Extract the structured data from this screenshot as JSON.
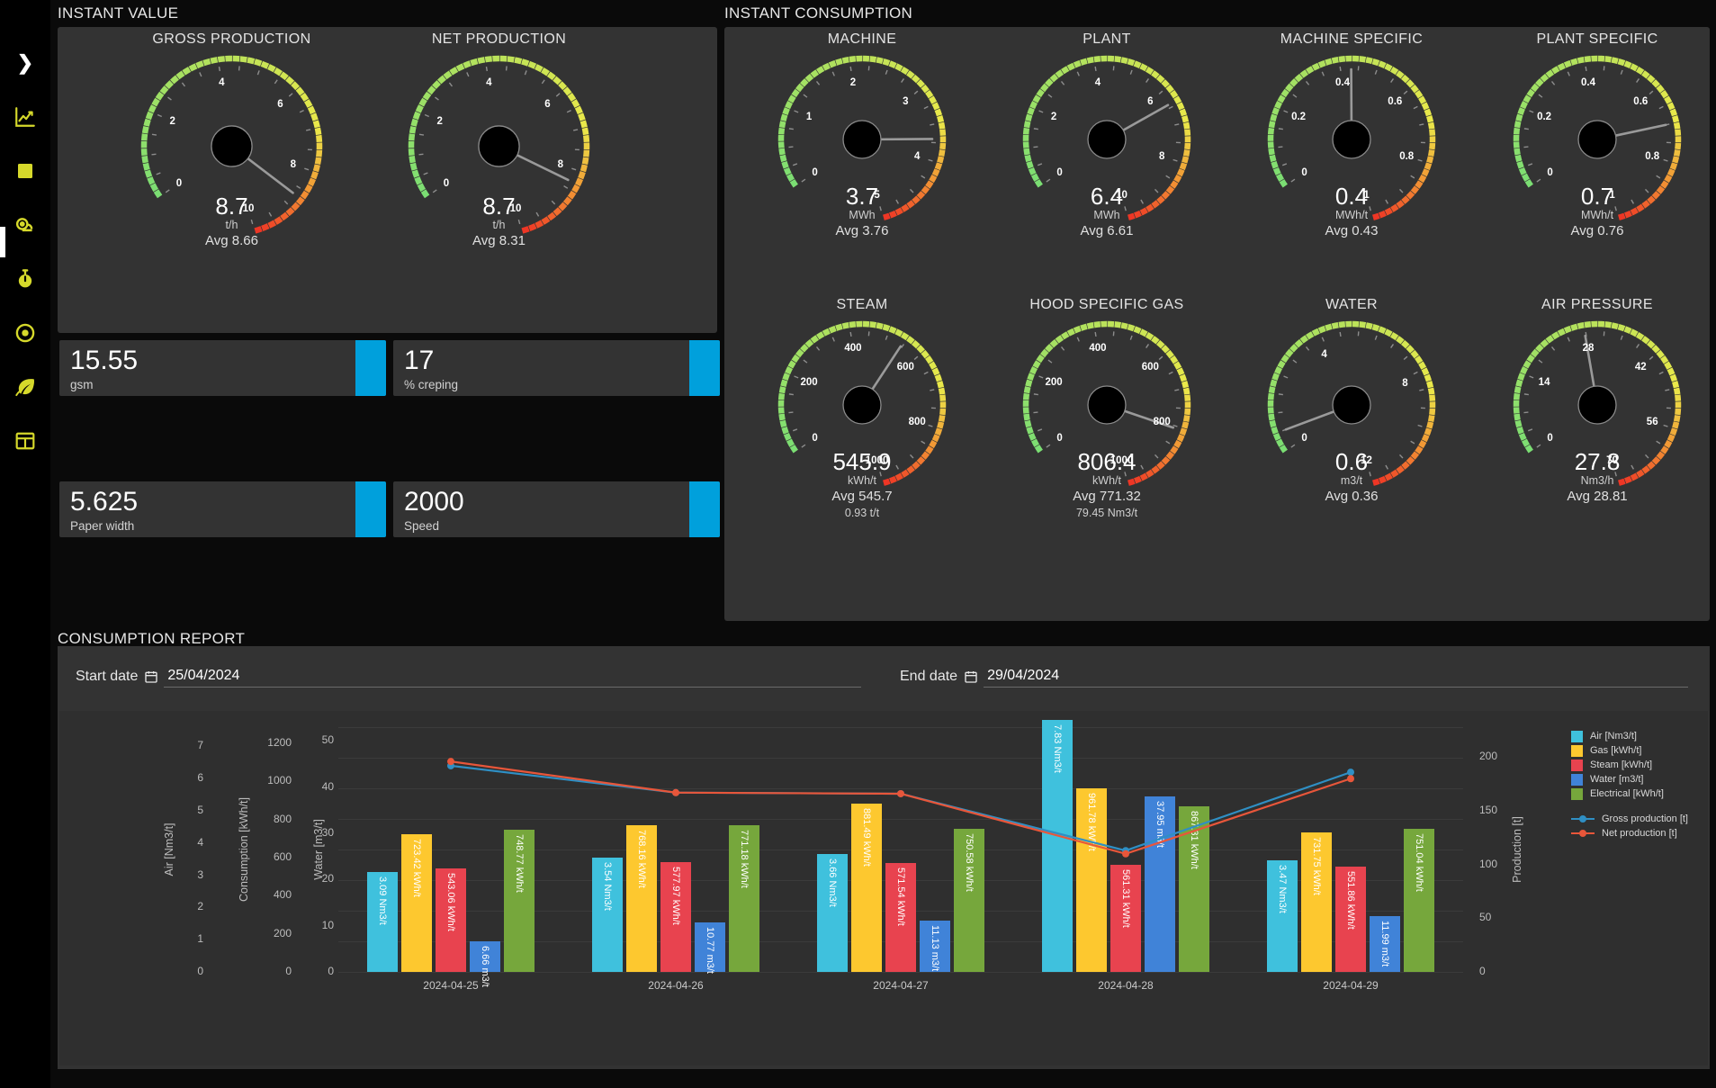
{
  "sidebar": {
    "items": [
      {
        "name": "expand-chevron",
        "icon": "chevron-right-icon"
      },
      {
        "name": "trend-chart",
        "icon": "trend-chart-icon"
      },
      {
        "name": "square-block",
        "icon": "square-icon"
      },
      {
        "name": "tape-measure",
        "icon": "tape-measure-icon"
      },
      {
        "name": "stopwatch",
        "icon": "stopwatch-icon"
      },
      {
        "name": "target",
        "icon": "target-icon"
      },
      {
        "name": "leaf",
        "icon": "leaf-icon"
      },
      {
        "name": "table-grid",
        "icon": "table-grid-icon"
      }
    ]
  },
  "sections": {
    "instant_value": "INSTANT VALUE",
    "instant_consumption": "INSTANT CONSUMPTION",
    "consumption_report": "CONSUMPTION REPORT"
  },
  "instant_value_gauges": [
    {
      "title": "GROSS PRODUCTION",
      "value": "8.7",
      "unit": "t/h",
      "avg": "Avg 8.66",
      "extra": "",
      "min": 0,
      "max": 10,
      "needle": 8.7,
      "ticks": [
        "0",
        "2",
        "4",
        "6",
        "8",
        "10"
      ]
    },
    {
      "title": "NET PRODUCTION",
      "value": "8.7",
      "unit": "t/h",
      "avg": "Avg 8.31",
      "extra": "",
      "min": 0,
      "max": 10,
      "needle": 8.31,
      "ticks": [
        "0",
        "2",
        "4",
        "6",
        "8",
        "10"
      ]
    }
  ],
  "instant_consumption_gauges": [
    {
      "title": "MACHINE",
      "value": "3.7",
      "unit": "MWh",
      "avg": "Avg 3.76",
      "extra": "",
      "min": 0,
      "max": 5,
      "needle": 3.7,
      "ticks": [
        "0",
        "1",
        "2",
        "3",
        "4",
        "5"
      ]
    },
    {
      "title": "PLANT",
      "value": "6.4",
      "unit": "MWh",
      "avg": "Avg 6.61",
      "extra": "",
      "min": 0,
      "max": 10,
      "needle": 6.4,
      "ticks": [
        "0",
        "2",
        "4",
        "6",
        "8",
        "10"
      ]
    },
    {
      "title": "MACHINE SPECIFIC",
      "value": "0.4",
      "unit": "MWh/t",
      "avg": "Avg 0.43",
      "extra": "",
      "min": 0,
      "max": 1,
      "needle": 0.43,
      "ticks": [
        "0",
        "0.2",
        "0.4",
        "0.6",
        "0.8",
        "1"
      ]
    },
    {
      "title": "PLANT SPECIFIC",
      "value": "0.7",
      "unit": "MWh/t",
      "avg": "Avg 0.76",
      "extra": "",
      "min": 0,
      "max": 1,
      "needle": 0.7,
      "ticks": [
        "0",
        "0.2",
        "0.4",
        "0.6",
        "0.8",
        "1"
      ]
    },
    {
      "title": "STEAM",
      "value": "545.9",
      "unit": "kWh/t",
      "avg": "Avg 545.7",
      "extra": "0.93 t/t",
      "min": 0,
      "max": 1000,
      "needle": 545.9,
      "ticks": [
        "0",
        "200",
        "400",
        "600",
        "800",
        "1000"
      ]
    },
    {
      "title": "HOOD SPECIFIC GAS",
      "value": "806.4",
      "unit": "kWh/t",
      "avg": "Avg 771.32",
      "extra": "79.45 Nm3/t",
      "min": 0,
      "max": 1000,
      "needle": 806.4,
      "ticks": [
        "0",
        "200",
        "400",
        "600",
        "800",
        "1000"
      ]
    },
    {
      "title": "WATER",
      "value": "0.6",
      "unit": "m3/t",
      "avg": "Avg 0.36",
      "extra": "",
      "min": 0,
      "max": 12,
      "needle": 0.6,
      "ticks": [
        "0",
        "4",
        "8",
        "12"
      ]
    },
    {
      "title": "AIR PRESSURE",
      "value": "27.8",
      "unit": "Nm3/h",
      "avg": "Avg 28.81",
      "extra": "",
      "min": 0,
      "max": 70,
      "needle": 27.8,
      "ticks": [
        "0",
        "14",
        "28",
        "42",
        "56",
        "70"
      ]
    }
  ],
  "kpis": [
    {
      "value": "15.55",
      "label": "gsm",
      "accent": "#00a0dc"
    },
    {
      "value": "17",
      "label": "% creping",
      "accent": "#00a0dc"
    },
    {
      "value": "5.625",
      "label": "Paper width",
      "accent": "#00a0dc"
    },
    {
      "value": "2000",
      "label": "Speed",
      "accent": "#00a0dc"
    }
  ],
  "report": {
    "start_label": "Start date",
    "start_value": "25/04/2024",
    "end_label": "End date",
    "end_value": "29/04/2024",
    "calendar_icon": "calendar-icon"
  },
  "chart_data": {
    "type": "bar",
    "title": "CONSUMPTION REPORT",
    "categories": [
      "2024-04-25",
      "2024-04-26",
      "2024-04-27",
      "2024-04-28",
      "2024-04-29"
    ],
    "grid": true,
    "legend_position": "right",
    "series": [
      {
        "name": "Air [Nm3/t]",
        "color": "#3fc1dd",
        "axis": "air",
        "values": [
          3.09,
          3.54,
          3.66,
          7.83,
          3.47
        ],
        "labels": [
          "3.09 Nm3/t",
          "3.54 Nm3/t",
          "3.66 Nm3/t",
          "7.83 Nm3/t",
          "3.47 Nm3/t"
        ]
      },
      {
        "name": "Gas [kWh/t]",
        "color": "#fdc82f",
        "axis": "consumption",
        "values": [
          723.42,
          768.16,
          881.49,
          961.78,
          731.75
        ],
        "labels": [
          "723.42 kWh/t",
          "768.16 kWh/t",
          "881.49 kWh/t",
          "961.78 kWh/t",
          "731.75 kWh/t"
        ]
      },
      {
        "name": "Steam [kWh/t]",
        "color": "#e8434f",
        "axis": "consumption",
        "values": [
          543.06,
          577.97,
          571.54,
          561.31,
          551.86
        ],
        "labels": [
          "543.06 kWh/t",
          "577.97 kWh/t",
          "571.54 kWh/t",
          "561.31 kWh/t",
          "551.86 kWh/t"
        ]
      },
      {
        "name": "Water [m3/t]",
        "color": "#4083d8",
        "axis": "water",
        "values": [
          6.66,
          10.77,
          11.13,
          37.95,
          11.99
        ],
        "labels": [
          "6.66 m3/t",
          "10.77 m3/t",
          "11.13 m3/t",
          "37.95 m3/t",
          "11.99 m3/t"
        ]
      },
      {
        "name": "Electrical [kWh/t]",
        "color": "#76a73c",
        "axis": "consumption",
        "values": [
          748.77,
          771.18,
          750.58,
          867.31,
          751.04
        ],
        "labels": [
          "748.77 kWh/t",
          "771.18 kWh/t",
          "750.58 kWh/t",
          "867.31 kWh/t",
          "751.04 kWh/t"
        ]
      }
    ],
    "lines": [
      {
        "name": "Gross production [t]",
        "color": "#2f8fc4",
        "axis": "production",
        "values": [
          192,
          167,
          166,
          113,
          186
        ]
      },
      {
        "name": "Net production [t]",
        "color": "#e8563a",
        "axis": "production",
        "values": [
          196,
          167,
          166,
          110,
          180
        ]
      }
    ],
    "axes": {
      "air": {
        "label": "Air [Nm3/t]",
        "ticks": [
          "0",
          "1",
          "2",
          "3",
          "4",
          "5",
          "6",
          "7"
        ],
        "min": 0,
        "max": 7.6
      },
      "consumption": {
        "label": "Consumption [kWh/t]",
        "ticks": [
          "0",
          "200",
          "400",
          "600",
          "800",
          "1000",
          "1200"
        ],
        "min": 0,
        "max": 1285
      },
      "water": {
        "label": "Water [m3/t]",
        "ticks": [
          "0",
          "10",
          "20",
          "30",
          "40",
          "50"
        ],
        "min": 0,
        "max": 53
      },
      "production": {
        "label": "Production [t]",
        "ticks": [
          "0",
          "50",
          "100",
          "150",
          "200"
        ],
        "min": 0,
        "max": 228
      }
    }
  }
}
